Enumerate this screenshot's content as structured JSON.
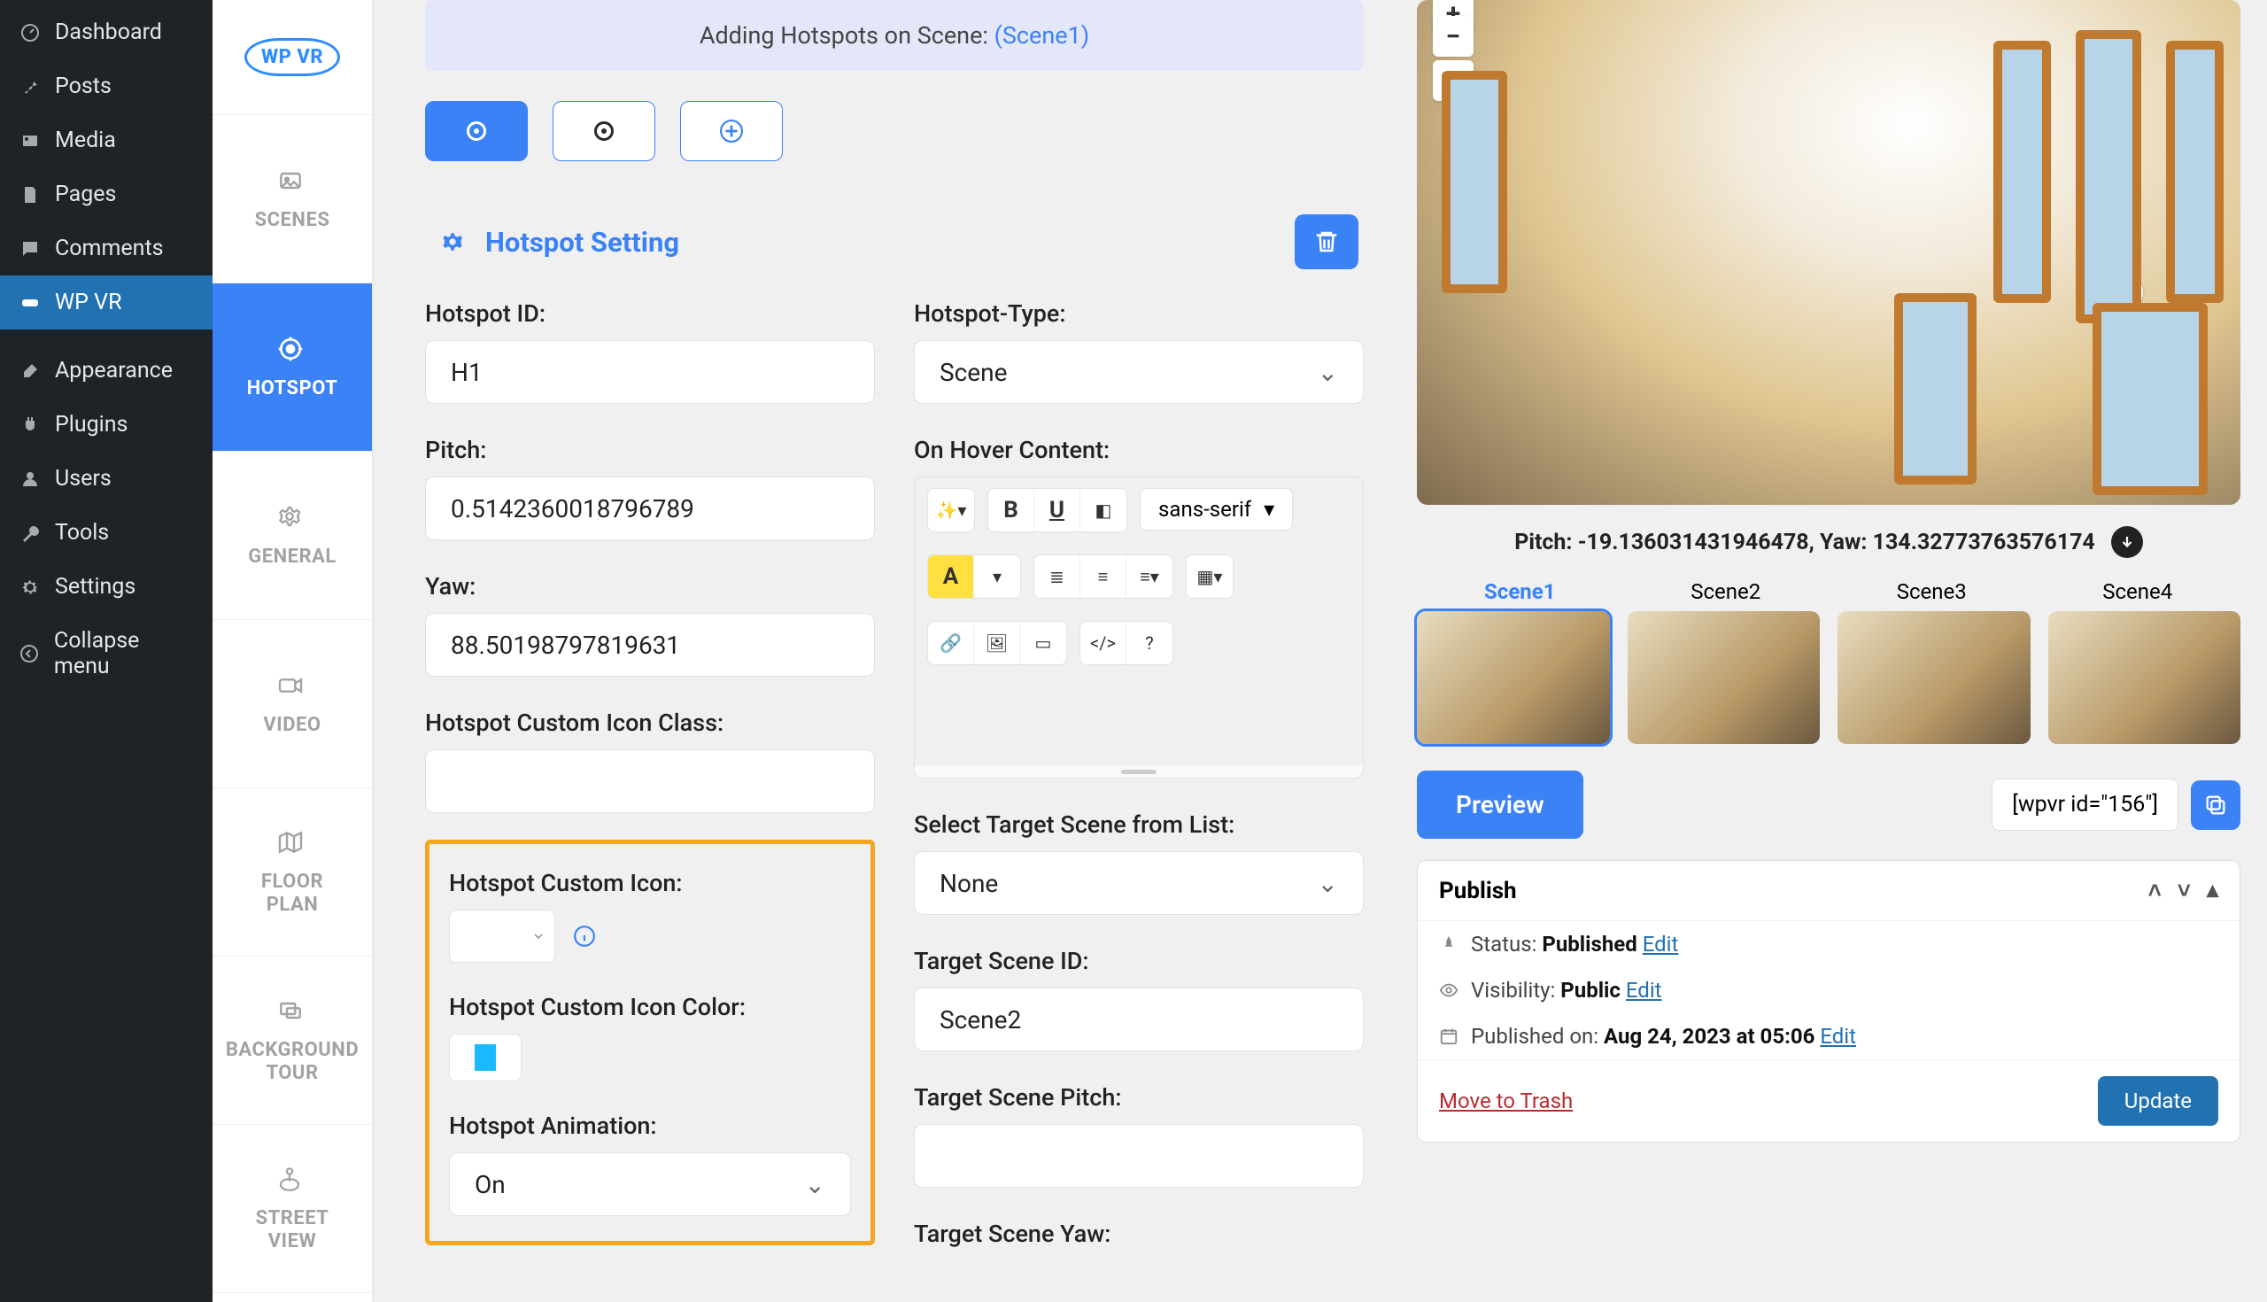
{
  "wp_sidebar": [
    {
      "icon": "dashboard",
      "label": "Dashboard"
    },
    {
      "icon": "pin",
      "label": "Posts"
    },
    {
      "icon": "media",
      "label": "Media"
    },
    {
      "icon": "page",
      "label": "Pages"
    },
    {
      "icon": "comment",
      "label": "Comments"
    },
    {
      "icon": "vr",
      "label": "WP VR",
      "current": true
    },
    {
      "sep": true
    },
    {
      "icon": "brush",
      "label": "Appearance"
    },
    {
      "icon": "plug",
      "label": "Plugins"
    },
    {
      "icon": "user",
      "label": "Users"
    },
    {
      "icon": "wrench",
      "label": "Tools"
    },
    {
      "icon": "gear",
      "label": "Settings"
    },
    {
      "icon": "collapse",
      "label": "Collapse menu"
    }
  ],
  "plugin_tabs": [
    {
      "key": "scenes",
      "label": "SCENES"
    },
    {
      "key": "hotspot",
      "label": "HOTSPOT",
      "active": true
    },
    {
      "key": "general",
      "label": "GENERAL"
    },
    {
      "key": "video",
      "label": "VIDEO"
    },
    {
      "key": "floorplan",
      "label": "FLOOR PLAN"
    },
    {
      "key": "bgtour",
      "label": "BACKGROUND TOUR"
    },
    {
      "key": "streetview",
      "label": "STREET VIEW"
    }
  ],
  "logo_text": "WP VR",
  "banner": {
    "prefix": "Adding Hotspots on Scene: ",
    "scene": "(Scene1)"
  },
  "hotspot_setting_title": "Hotspot Setting",
  "left_col": {
    "hotspot_id_label": "Hotspot ID:",
    "hotspot_id_value": "H1",
    "pitch_label": "Pitch:",
    "pitch_value": "0.5142360018796789",
    "yaw_label": "Yaw:",
    "yaw_value": "88.50198797819631",
    "icon_class_label": "Hotspot Custom Icon Class:",
    "icon_class_value": "",
    "custom_icon_label": "Hotspot Custom Icon:",
    "icon_color_label": "Hotspot Custom Icon Color:",
    "icon_color_value": "#18b9ff",
    "animation_label": "Hotspot Animation:",
    "animation_value": "On"
  },
  "right_col": {
    "type_label": "Hotspot-Type:",
    "type_value": "Scene",
    "hover_label": "On Hover Content:",
    "font_family": "sans-serif",
    "target_list_label": "Select Target Scene from List:",
    "target_list_value": "None",
    "target_id_label": "Target Scene ID:",
    "target_id_value": "Scene2",
    "target_pitch_label": "Target Scene Pitch:",
    "target_pitch_value": "",
    "target_yaw_label": "Target Scene Yaw:"
  },
  "preview": {
    "pitch_prefix": "Pitch: ",
    "pitch_val": "-19.136031431946478",
    "yaw_prefix": ", Yaw: ",
    "yaw_val": "134.32773763576174",
    "scenes": [
      "Scene1",
      "Scene2",
      "Scene3",
      "Scene4"
    ],
    "preview_btn": "Preview",
    "shortcode": "[wpvr id=\"156\"]"
  },
  "publish": {
    "title": "Publish",
    "status_label": "Status: ",
    "status_value": "Published",
    "visibility_label": "Visibility: ",
    "visibility_value": "Public",
    "published_label": "Published on: ",
    "published_value": "Aug 24, 2023 at 05:06",
    "edit": "Edit",
    "trash": "Move to Trash",
    "update": "Update"
  }
}
